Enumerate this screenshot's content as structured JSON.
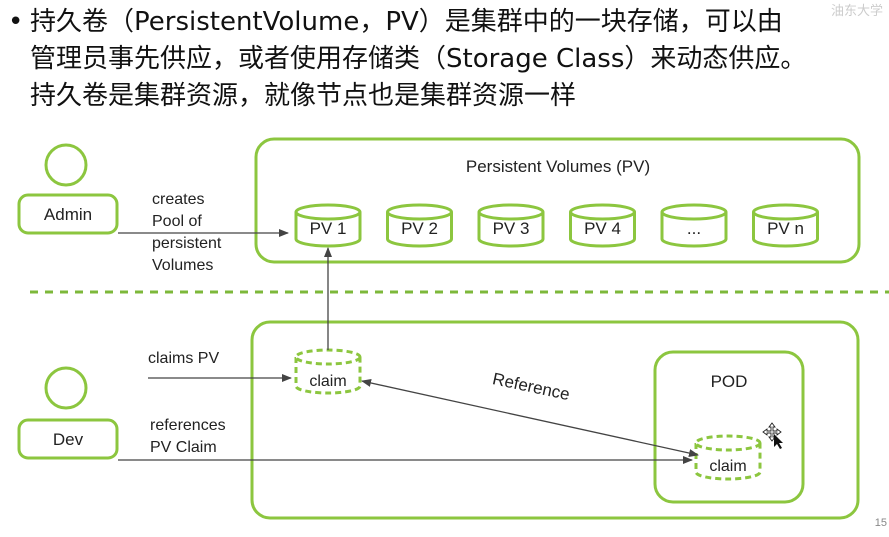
{
  "slide": {
    "bullet_symbol": "•",
    "lines": [
      "持久卷（PersistentVolume，PV）是集群中的一块存储，可以由",
      "管理员事先供应，或者使用存储类（Storage Class）来动态供应。",
      "持久卷是集群资源，就像节点也是集群资源一样"
    ],
    "page_number": "15",
    "watermark": "油东大学"
  },
  "diagram": {
    "pv_box_title": "Persistent Volumes (PV)",
    "volumes": [
      "PV 1",
      "PV 2",
      "PV 3",
      "PV 4",
      "...",
      "PV n"
    ],
    "admin_label": "Admin",
    "dev_label": "Dev",
    "admin_action": [
      "creates",
      "Pool of",
      "persistent",
      "Volumes"
    ],
    "claims_label": "claims PV",
    "references_label": [
      "references",
      "PV Claim"
    ],
    "claim_label": "claim",
    "pod_claim_label": "claim",
    "pod_label": "POD",
    "reference_label": "Reference",
    "colors": {
      "accent": "#8cc63f",
      "divider": "#7db83a",
      "arrow": "#444444"
    }
  }
}
